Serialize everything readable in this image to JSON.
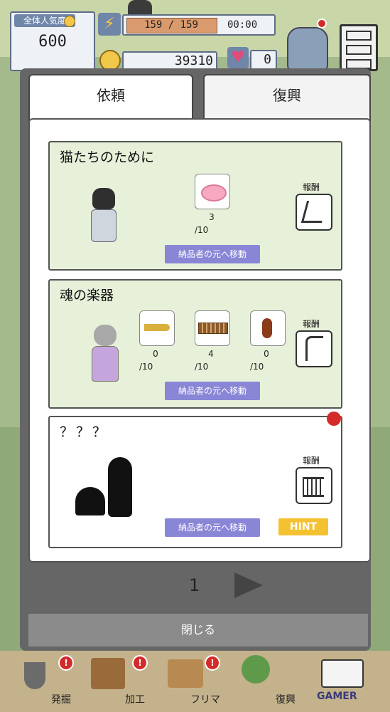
{
  "hud": {
    "popularity_label": "全体人気度",
    "popularity_value": "600",
    "stamina": "159 / 159",
    "timer": "00:00",
    "coins": "39310",
    "hearts": "0"
  },
  "tabs": [
    {
      "label": "依頼",
      "active": true
    },
    {
      "label": "復興",
      "active": false
    }
  ],
  "requests": [
    {
      "title": "猫たちのために",
      "items": [
        {
          "icon": "pink-cat-bed-icon",
          "count": "3",
          "total": "/10"
        }
      ],
      "reward_label": "報酬",
      "reward_icon": "cat-scratcher-icon",
      "move_label": "納品者の元へ移動"
    },
    {
      "title": "魂の楽器",
      "items": [
        {
          "icon": "trumpet-icon",
          "count": "0",
          "total": "/10"
        },
        {
          "icon": "xylophone-icon",
          "count": "4",
          "total": "/10"
        },
        {
          "icon": "violin-icon",
          "count": "0",
          "total": "/10"
        }
      ],
      "reward_label": "報酬",
      "reward_icon": "harp-icon",
      "move_label": "納品者の元へ移動"
    },
    {
      "title": "？？？",
      "reward_label": "報酬",
      "reward_icon": "crib-icon",
      "move_label": "納品者の元へ移動",
      "hint_label": "HINT"
    }
  ],
  "pagination": {
    "page": "1"
  },
  "close_label": "閉じる",
  "bottom_nav": [
    {
      "label": "発掘",
      "alert": "!"
    },
    {
      "label": "加工",
      "alert": "!"
    },
    {
      "label": "フリマ",
      "alert": "!"
    },
    {
      "label": "復興",
      "alert": ""
    }
  ],
  "watermark": "GAMER"
}
